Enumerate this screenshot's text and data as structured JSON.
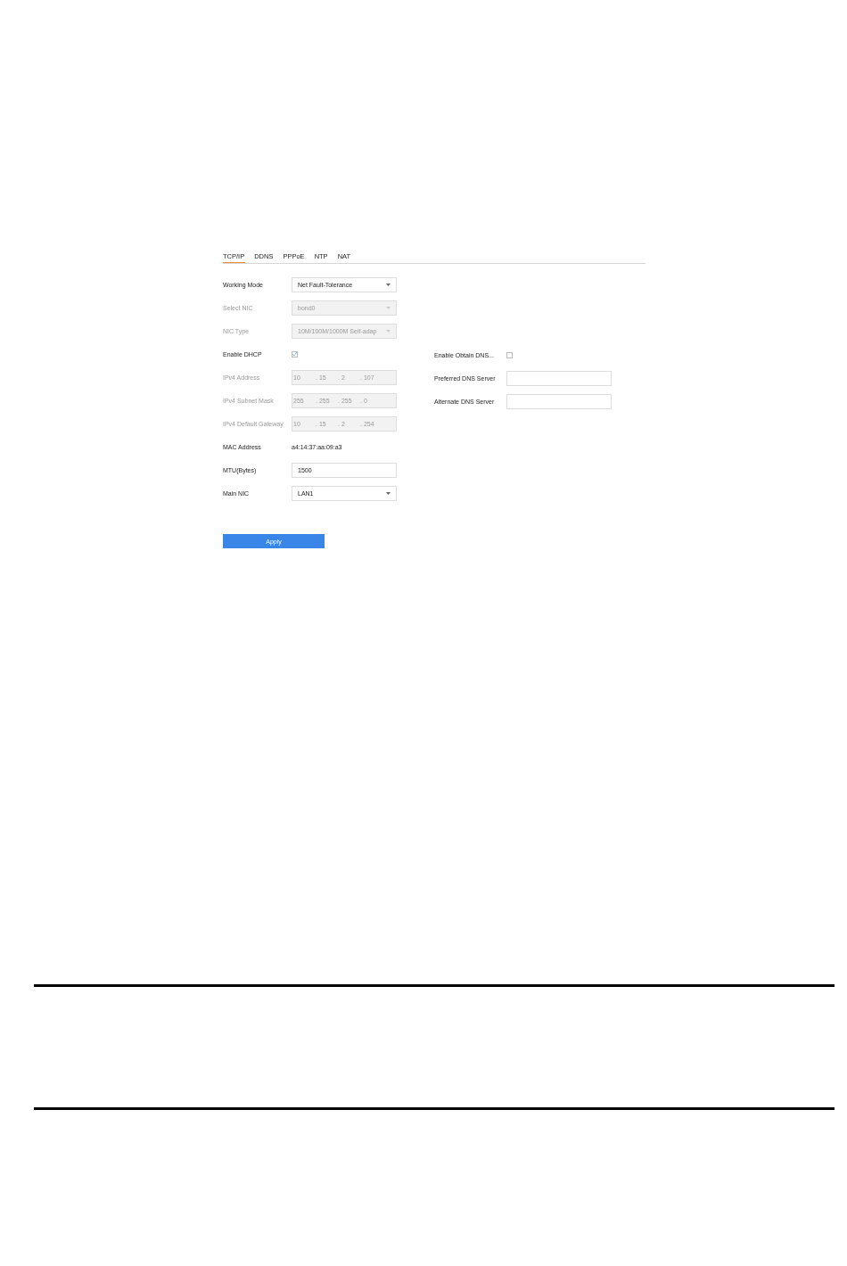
{
  "tabs": [
    {
      "label": "TCP/IP",
      "selected": true
    },
    {
      "label": "DDNS",
      "selected": false
    },
    {
      "label": "PPPoE",
      "selected": false
    },
    {
      "label": "NTP",
      "selected": false
    },
    {
      "label": "NAT",
      "selected": false
    }
  ],
  "left_fields": [
    {
      "label": "Working Mode",
      "kind": "select",
      "value": "Net Fault-Tolerance",
      "disabled": false
    },
    {
      "label": "Select NIC",
      "kind": "select",
      "value": "bond0",
      "disabled": true
    },
    {
      "label": "NIC Type",
      "kind": "select",
      "value": "10M/100M/1000M Self-adap",
      "disabled": true
    },
    {
      "label": "Enable DHCP",
      "kind": "checkbox",
      "checked": true,
      "disabled": false
    },
    {
      "label": "IPv4 Address",
      "kind": "ip",
      "segments": [
        "10",
        ". 15",
        ". 2",
        ". 107"
      ],
      "disabled": true
    },
    {
      "label": "IPv4 Subnet Mask",
      "kind": "ip",
      "segments": [
        "255",
        ". 255",
        ". 255",
        ". 0"
      ],
      "disabled": true
    },
    {
      "label": "IPv4 Default Gateway",
      "kind": "ip",
      "segments": [
        "10",
        ". 15",
        ". 2",
        ". 254"
      ],
      "disabled": true
    },
    {
      "label": "MAC Address",
      "kind": "text",
      "value": "a4:14:37:aa:09:a3",
      "disabled": false
    },
    {
      "label": "MTU(Bytes)",
      "kind": "input",
      "value": "1500",
      "disabled": false
    },
    {
      "label": "Main NIC",
      "kind": "select",
      "value": "LAN1",
      "disabled": false
    }
  ],
  "right_fields": [
    {
      "label": "Enable Obtain DNS...",
      "kind": "checkbox",
      "checked": false,
      "disabled": false
    },
    {
      "label": "Preferred DNS Server",
      "kind": "input",
      "disabled": false
    },
    {
      "label": "Alternate DNS Server",
      "kind": "input",
      "disabled": false
    }
  ],
  "apply_button": "Apply"
}
